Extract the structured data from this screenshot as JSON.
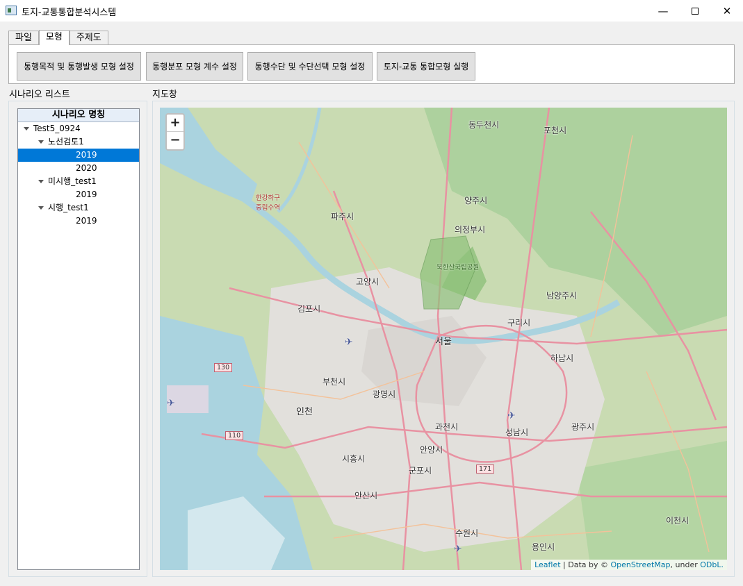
{
  "window": {
    "title": "토지-교통통합분석시스템"
  },
  "tabs": [
    {
      "label": "파일"
    },
    {
      "label": "모형"
    },
    {
      "label": "주제도"
    }
  ],
  "ribbon": {
    "buttons": [
      {
        "label": "통행목적 및 통행발생 모형 설정"
      },
      {
        "label": "통행분포 모형 계수 설정"
      },
      {
        "label": "통행수단 및 수단선택 모형 설정"
      },
      {
        "label": "토지-교통 통합모형 실행"
      }
    ]
  },
  "scenario_panel": {
    "label": "시나리오 리스트",
    "column_header": "시나리오 명칭",
    "tree": [
      {
        "text": "Test5_0924",
        "level": 0,
        "expanded": true
      },
      {
        "text": "노선검토1",
        "level": 1,
        "expanded": true
      },
      {
        "text": "2019",
        "level": 2,
        "selected": true
      },
      {
        "text": "2020",
        "level": 2
      },
      {
        "text": "미시행_test1",
        "level": 1,
        "expanded": true
      },
      {
        "text": "2019",
        "level": 2
      },
      {
        "text": "시행_test1",
        "level": 1,
        "expanded": true
      },
      {
        "text": "2019",
        "level": 2
      }
    ]
  },
  "map_panel": {
    "label": "지도창",
    "zoom_in": "+",
    "zoom_out": "−",
    "attribution": {
      "leaflet": "Leaflet",
      "sep": " | Data by © ",
      "osm": "OpenStreetMap",
      "under": ", under ",
      "license": "ODbL."
    },
    "places": {
      "seoul": "서울",
      "goyang": "고양시",
      "gimpo": "김포시",
      "paju": "파주시",
      "uijeongbu": "의정부시",
      "yangju": "양주시",
      "dongducheon": "동두천시",
      "pocheon": "포천시",
      "guri": "구리시",
      "namyangju": "남양주시",
      "hanam": "하남시",
      "bucheon": "부천시",
      "gwangmyeong": "광명시",
      "incheon": "인천",
      "gwacheon": "과천시",
      "seongnam": "성남시",
      "gwangju": "광주시",
      "anyang": "안양시",
      "siheung": "시흥시",
      "gunpo": "군포시",
      "ansan": "안산시",
      "suwon": "수원시",
      "yongin": "용인시",
      "icheon": "이천시",
      "hangang_reserve": "한강하구\n중립수역",
      "bukhansan": "북한산국립공원"
    },
    "road_shields": [
      "130",
      "110",
      "171"
    ]
  },
  "colors": {
    "selection": "#0078d7",
    "water": "#aad3df",
    "forest": "#add19e",
    "urban": "#e0dfdf",
    "road": "#e892a2"
  }
}
